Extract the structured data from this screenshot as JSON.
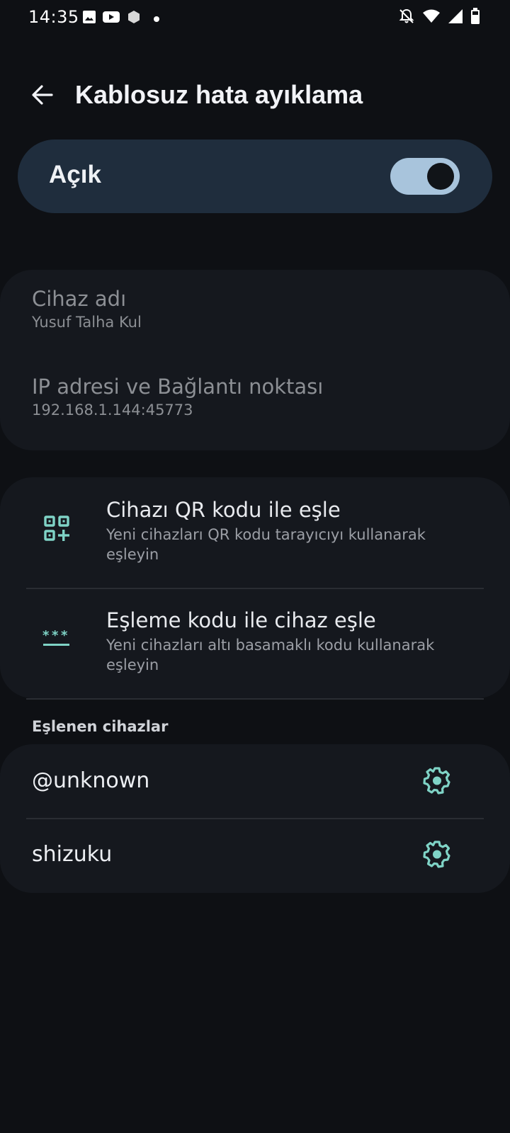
{
  "status_bar": {
    "time": "14:35",
    "left_icons": [
      "image-icon",
      "youtube-icon",
      "app-hexagon-icon",
      "notification-dot-icon"
    ],
    "right_icons": [
      "bell-off-icon",
      "wifi-icon",
      "cell-signal-icon",
      "battery-icon"
    ]
  },
  "header": {
    "title": "Kablosuz hata ayıklama",
    "back_icon": "arrow-left-icon"
  },
  "main_toggle": {
    "label": "Açık",
    "enabled": true
  },
  "info": {
    "device_name_title": "Cihaz adı",
    "device_name_value": "Yusuf Talha Kul",
    "ip_title": "IP adresi ve Bağlantı noktası",
    "ip_value": "192.168.1.144:45773"
  },
  "pairing": [
    {
      "icon": "qr-code-add-icon",
      "title": "Cihazı QR kodu ile eşle",
      "subtitle": "Yeni cihazları QR kodu tarayıcıyı kullanarak eşleyin"
    },
    {
      "icon": "password-asterisks-icon",
      "title": "Eşleme kodu ile cihaz eşle",
      "subtitle": "Yeni cihazları altı basamaklı kodu kullanarak eşleyin"
    }
  ],
  "paired_devices": {
    "header": "Eşlenen cihazlar",
    "items": [
      {
        "name": "@unknown",
        "icon": "gear-icon"
      },
      {
        "name": "shizuku",
        "icon": "gear-icon"
      }
    ]
  },
  "colors": {
    "background": "#0e1014",
    "card": "#15181e",
    "toggle_card": "#1f2d3d",
    "switch_track": "#a8c4dc",
    "accent_icon": "#7fd3c6"
  }
}
